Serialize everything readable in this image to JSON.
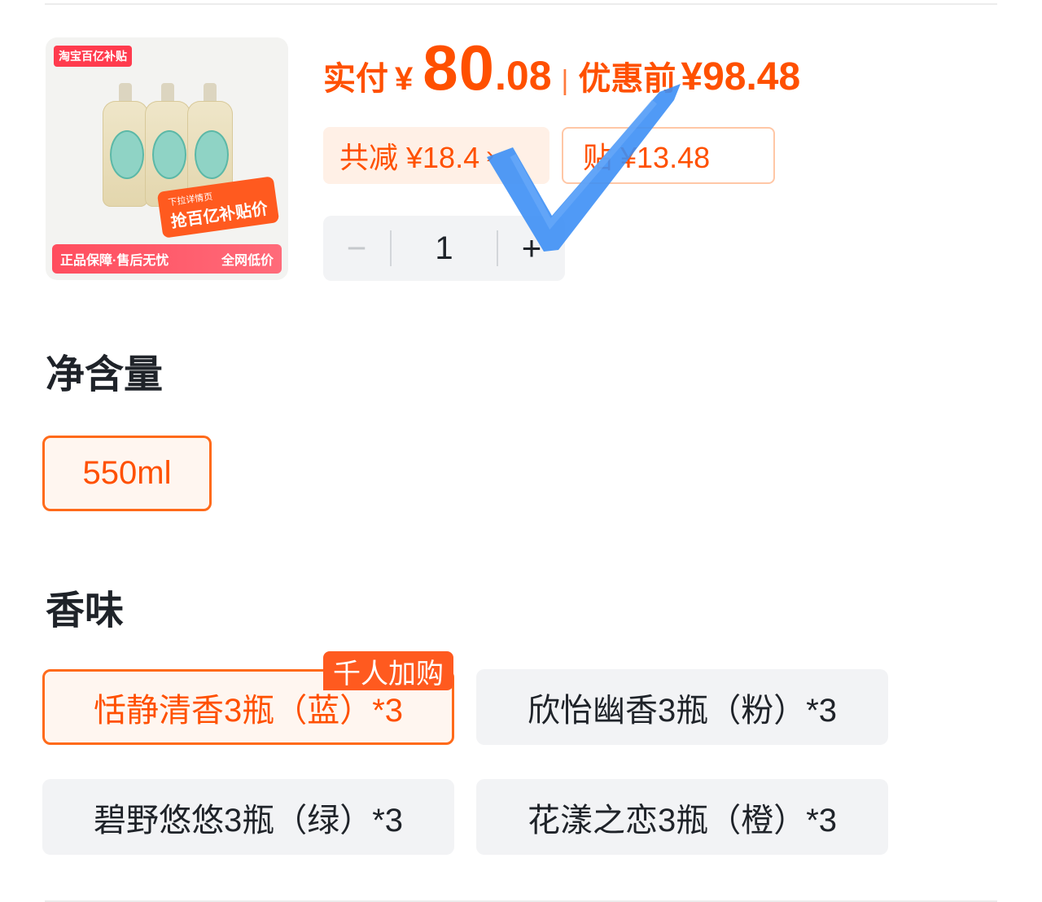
{
  "colors": {
    "accent": "#ff5000",
    "accent_border": "#ff6a1a",
    "chip_bg": "#fff0e6",
    "option_bg": "#f2f3f5",
    "check_mark": "#3d8ff5"
  },
  "product": {
    "image": {
      "tag": "淘宝百亿补贴",
      "promo_small": "下拉详情页",
      "promo_main": "抢百亿补贴价",
      "bottom_left": "正品保障·售后无忧",
      "bottom_right": "全网低价"
    }
  },
  "price": {
    "label": "实付",
    "currency": "¥",
    "integer": "80",
    "decimal": ".08",
    "separator": "|",
    "original_label": "优惠前",
    "original_value": "¥98.48"
  },
  "discounts": {
    "total": "共减 ¥18.4",
    "total_chevron": "›",
    "subsidy": "贴 ¥13.48"
  },
  "quantity": {
    "minus": "−",
    "value": "1",
    "plus": "+"
  },
  "overlay": {
    "icon": "check-mark-icon"
  },
  "volume": {
    "title": "净含量",
    "options": [
      "550ml"
    ],
    "selected": "550ml"
  },
  "scent": {
    "title": "香味",
    "badge": "千人加购",
    "options": [
      "恬静清香3瓶（蓝）*3",
      "欣怡幽香3瓶（粉）*3",
      "碧野悠悠3瓶（绿）*3",
      "花漾之恋3瓶（橙）*3"
    ],
    "selected": "恬静清香3瓶（蓝）*3"
  }
}
